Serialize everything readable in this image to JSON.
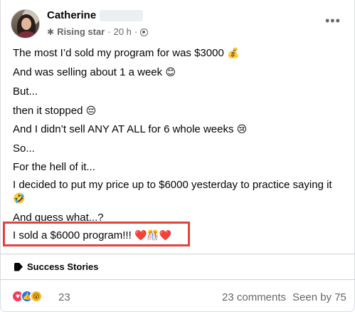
{
  "post": {
    "author_name": "Catherine",
    "badge": "Rising star",
    "separator": "·",
    "time": "20 h",
    "separator2": "·",
    "more_label": "•••",
    "lines": [
      "The most I’d sold my program for was $3000",
      "And was selling about 1 a week",
      "But...",
      "then it stopped",
      "And I didn’t sell ANY AT ALL for 6 whole weeks",
      "So...",
      "For the hell of it...",
      "I decided to put my price up to $6000 yesterday to practice saying it",
      "And guess what...?",
      "I sold a $6000 program!!!"
    ],
    "emojis": {
      "money_bag": "💰",
      "smile": "😊",
      "pensive": "😔",
      "crying": "😢",
      "rofl": "🤣",
      "celebration": "❤️🎊❤️"
    }
  },
  "tag": {
    "label": "Success Stories",
    "icon": "tag-icon"
  },
  "stats": {
    "reaction_icons": [
      "love-reaction-icon",
      "like-reaction-icon",
      "wow-reaction-icon"
    ],
    "reaction_count": "23",
    "comments": "23 comments",
    "seen": "Seen by 75"
  },
  "colors": {
    "highlight_border": "#e0443b",
    "meta_gray": "#65676b",
    "like_blue": "#1877f2",
    "love_red": "#f33e58"
  }
}
